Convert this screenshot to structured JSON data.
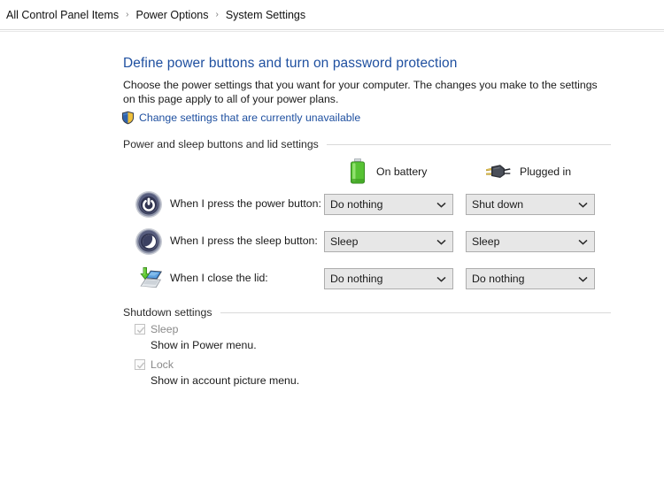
{
  "breadcrumb": {
    "separator": "›",
    "items": [
      {
        "label": "All Control Panel Items"
      },
      {
        "label": "Power Options"
      },
      {
        "label": "System Settings"
      }
    ]
  },
  "page": {
    "title": "Define power buttons and turn on password protection",
    "intro": "Choose the power settings that you want for your computer. The changes you make to the settings on this page apply to all of your power plans.",
    "uac_link": "Change settings that are currently unavailable",
    "uac_icon": "shield-icon"
  },
  "power_group": {
    "header": "Power and sleep buttons and lid settings",
    "columns": [
      {
        "label": "On battery",
        "icon": "battery-icon"
      },
      {
        "label": "Plugged in",
        "icon": "power-plug-icon"
      }
    ],
    "rows": [
      {
        "icon": "power-button-icon",
        "label": "When I press the power button:",
        "on_battery": "Do nothing",
        "plugged_in": "Shut down"
      },
      {
        "icon": "sleep-moon-icon",
        "label": "When I press the sleep button:",
        "on_battery": "Sleep",
        "plugged_in": "Sleep"
      },
      {
        "icon": "laptop-lid-icon",
        "label": "When I close the lid:",
        "on_battery": "Do nothing",
        "plugged_in": "Do nothing"
      }
    ]
  },
  "shutdown_group": {
    "header": "Shutdown settings",
    "options": [
      {
        "label": "Sleep",
        "description": "Show in Power menu.",
        "checked": "true",
        "enabled": "false"
      },
      {
        "label": "Lock",
        "description": "Show in account picture menu.",
        "checked": "true",
        "enabled": "false"
      }
    ]
  },
  "colors": {
    "link": "#1f50a0",
    "heading": "#1f50a0",
    "text": "#1a1a1a",
    "disabled_text": "#8a8a8a",
    "combo_bg": "#e7e7e7",
    "combo_border": "#adadad",
    "rule": "#d9d9d9",
    "battery_green": "#4caf2e",
    "shield_blue": "#2f63ad",
    "shield_gold": "#f0c03a"
  }
}
